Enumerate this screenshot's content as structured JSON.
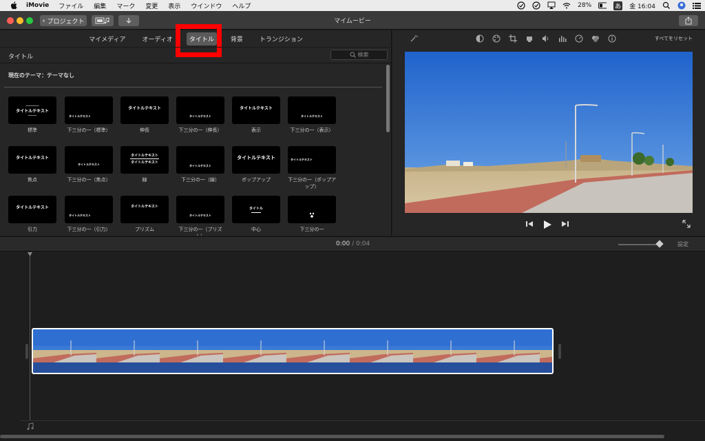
{
  "menubar": {
    "app": "iMovie",
    "items": [
      "ファイル",
      "編集",
      "マーク",
      "変更",
      "表示",
      "ウインドウ",
      "ヘルプ"
    ],
    "battery": "28%",
    "input_method": "あ",
    "clock": "金 16:04"
  },
  "titlebar": {
    "project_button": "プロジェクト",
    "title": "マイムービー"
  },
  "browser": {
    "tabs": [
      "マイメディア",
      "オーディオ",
      "タイトル",
      "背景",
      "トランジション"
    ],
    "active_tab": "タイトル",
    "section_label": "タイトル",
    "search_placeholder": "検索",
    "theme": "現在のテーマ：テーマなし",
    "titles": [
      {
        "label": "標準",
        "preview": "タイトルテキスト"
      },
      {
        "label": "下三分の一（標準）",
        "preview": "タイトルテキスト"
      },
      {
        "label": "伸長",
        "preview": "タイトルテキスト"
      },
      {
        "label": "下三分の一（伸長）",
        "preview": "タイトルテキスト"
      },
      {
        "label": "表示",
        "preview": "タイトルテキスト"
      },
      {
        "label": "下三分の一（表示）",
        "preview": "タイトルテキスト"
      },
      {
        "label": "焦点",
        "preview": "タイトルテキスト"
      },
      {
        "label": "下三分の一（焦点）",
        "preview": "タイトルテキスト"
      },
      {
        "label": "線",
        "preview": "タイトルテキスト"
      },
      {
        "label": "下三分の一（線）",
        "preview": "タイトルテキスト"
      },
      {
        "label": "ポップアップ",
        "preview": "タイトルテキスト"
      },
      {
        "label": "下三分の一（ポップアップ）",
        "preview": "タイトルテキスト"
      },
      {
        "label": "引力",
        "preview": "タイトルテキスト"
      },
      {
        "label": "下三分の一（引力）",
        "preview": "タイトルテキスト"
      },
      {
        "label": "プリズム",
        "preview": "タイトルテキスト"
      },
      {
        "label": "下三分の一（プリズム）",
        "preview": "タイトルテキスト"
      },
      {
        "label": "中心",
        "preview": "タイトル"
      },
      {
        "label": "下三分の一",
        "preview": ""
      }
    ]
  },
  "viewer": {
    "reset_label": "すべてをリセット"
  },
  "timeline": {
    "current_time": "0:00",
    "separator": "/",
    "total_time": "0:04",
    "settings_label": "設定"
  },
  "colors": {
    "highlight": "#ff0000",
    "sky": "#2f6fd1",
    "clip_band": "#274f9c"
  }
}
